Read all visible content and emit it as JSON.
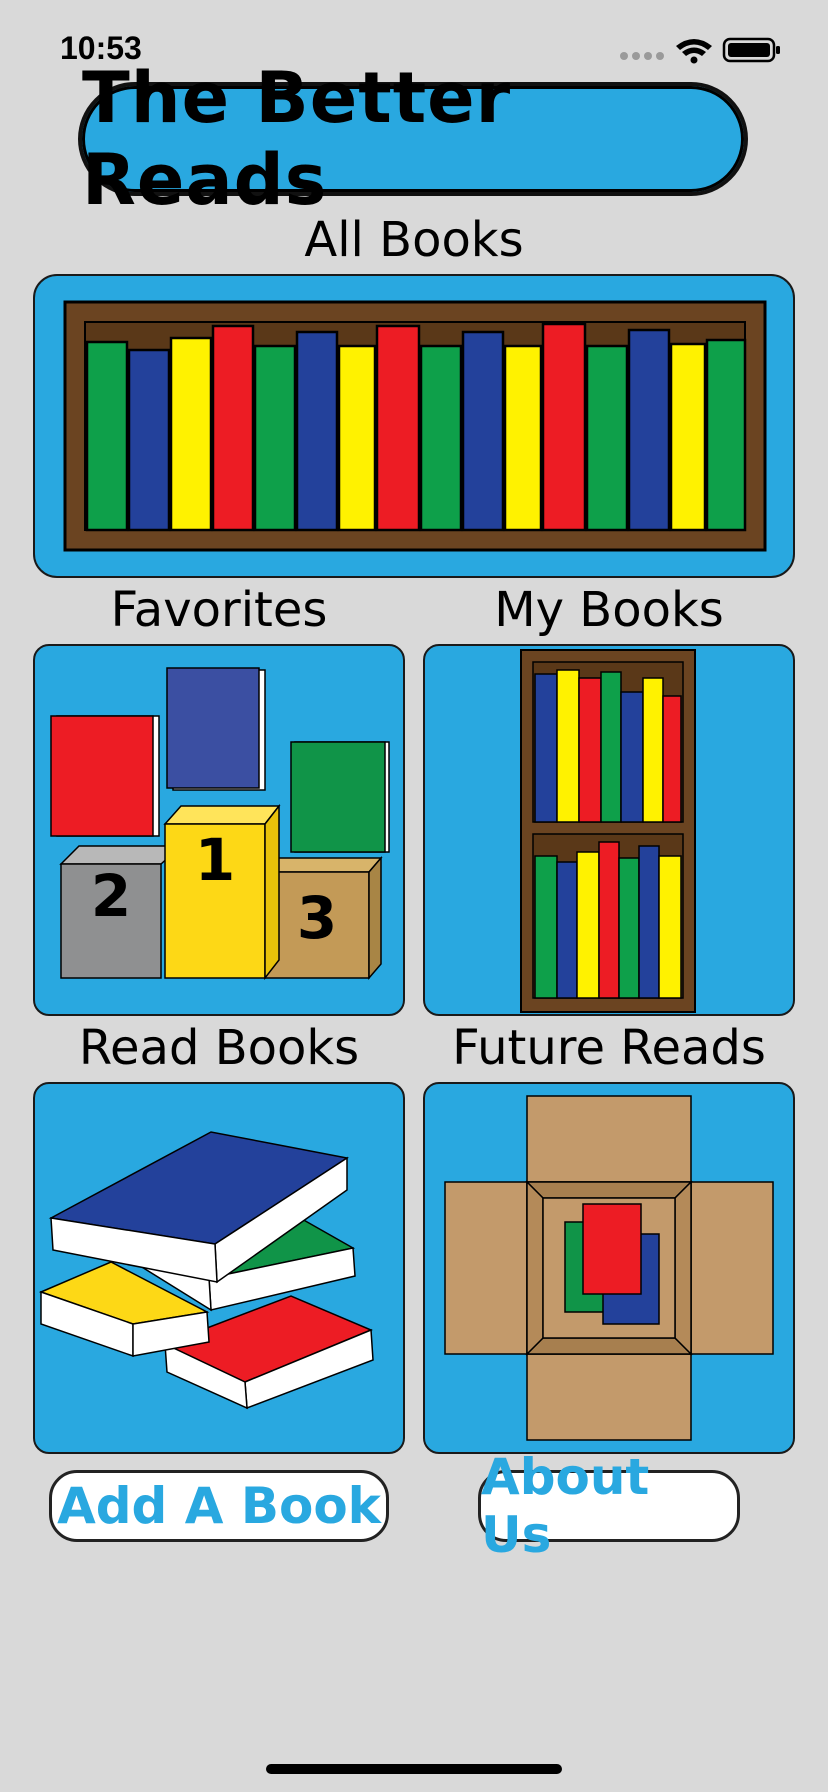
{
  "status_bar": {
    "time": "10:53",
    "icons": [
      "signal-dots-icon",
      "wifi-icon",
      "battery-icon"
    ]
  },
  "header": {
    "title": "The Better Reads"
  },
  "sections": {
    "all_books": "All Books",
    "favorites": "Favorites",
    "my_books": "My Books",
    "read_books": "Read Books",
    "future_reads": "Future Reads"
  },
  "podium_numbers": [
    "1",
    "2",
    "3"
  ],
  "buttons": {
    "add_book": "Add A Book",
    "about_us": "About Us"
  },
  "colors": {
    "accent": "#29a8e0",
    "background": "#d9d9d9",
    "shelf_brown": "#6b4421"
  }
}
